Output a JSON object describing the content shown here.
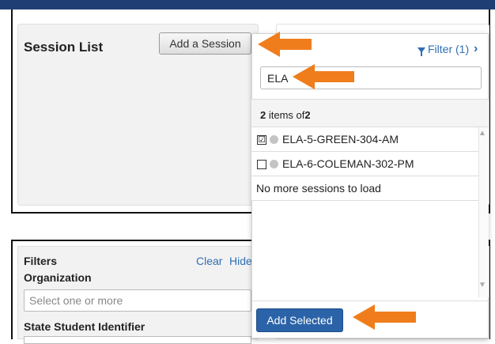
{
  "session_list": {
    "title": "Session List",
    "add_button": "Add a Session"
  },
  "popover": {
    "filter_label": "Filter (1)",
    "search_value": "ELA",
    "count_prefix": "2",
    "count_middle": " items of",
    "count_total": "2",
    "rows": [
      {
        "name": "ELA-5-GREEN-304-AM",
        "checked": "☑"
      },
      {
        "name": "ELA-6-COLEMAN-302-PM",
        "checked": ""
      }
    ],
    "no_more": "No more sessions to load",
    "add_selected": "Add Selected"
  },
  "filters": {
    "title": "Filters",
    "clear": "Clear",
    "hide": "Hide",
    "organization_label": "Organization",
    "organization_placeholder": "Select one or more",
    "state_student_id_label": "State Student Identifier"
  },
  "colors": {
    "accent_blue": "#2b63a8",
    "link_blue": "#2f6fb5",
    "arrow_orange": "#f07d1c",
    "top_bar": "#1f3e73"
  }
}
